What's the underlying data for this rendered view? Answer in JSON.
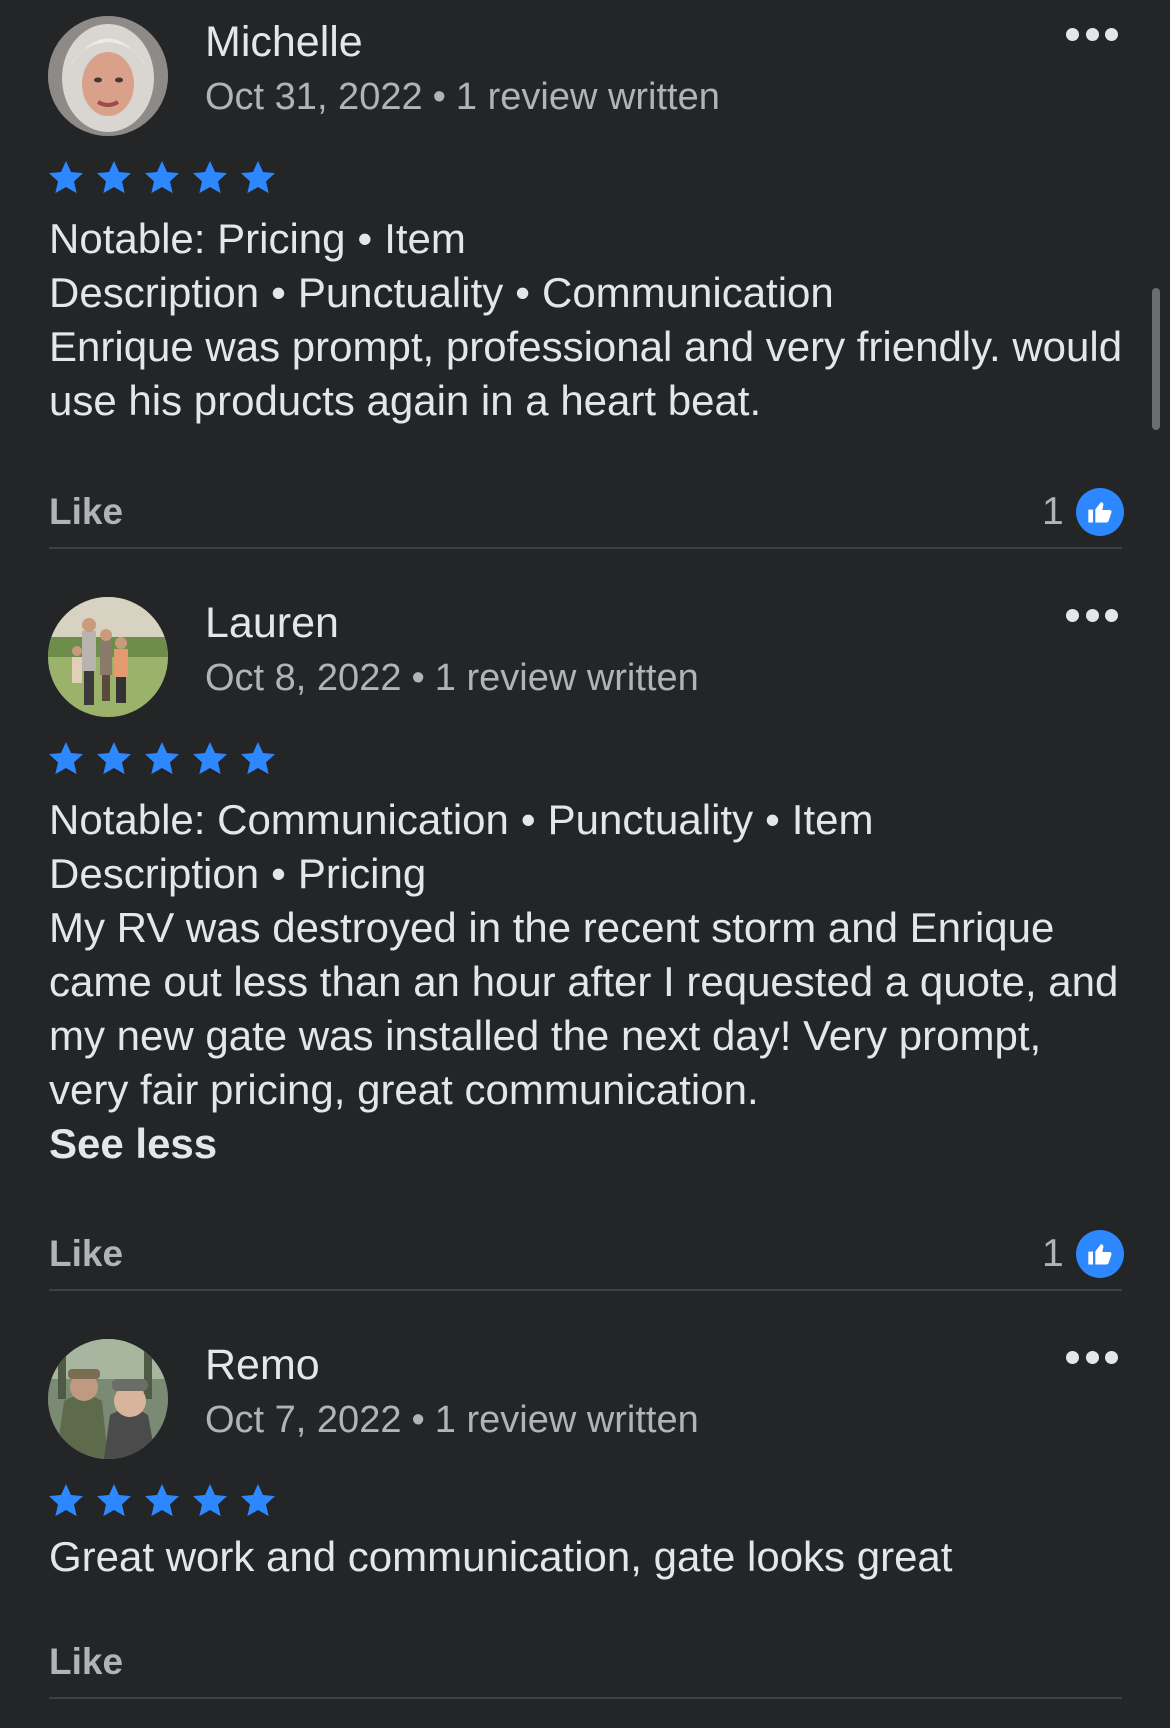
{
  "colors": {
    "background": "#242526",
    "primary_text": "#e4e6eb",
    "secondary_text": "#b0b3b8",
    "star": "#2d88ff",
    "like_badge": "#2d88ff",
    "divider": "#3e4042"
  },
  "icons": {
    "more": "three-dots-icon",
    "star": "star-icon",
    "like_badge": "thumbs-up-icon"
  },
  "reviews": [
    {
      "name": "Michelle",
      "date": "Oct 31, 2022",
      "meta_sep": "•",
      "reviews_written": "1 review written",
      "rating": 5,
      "notable_prefix": "Notable:",
      "notable_tags": [
        "Pricing",
        "Item Description",
        "Punctuality",
        "Communication"
      ],
      "tag_sep": "•",
      "text": "Enrique was prompt, professional and very friendly. would use his products again in a heart beat.",
      "like_label": "Like",
      "like_count": "1"
    },
    {
      "name": "Lauren",
      "date": "Oct 8, 2022",
      "meta_sep": "•",
      "reviews_written": "1 review written",
      "rating": 5,
      "notable_prefix": "Notable:",
      "notable_tags": [
        "Communication",
        "Punctuality",
        "Item Description",
        "Pricing"
      ],
      "tag_sep": "•",
      "text": "My RV was destroyed in the recent storm and Enrique came out less than an hour after I requested a quote, and my new gate was installed the next day! Very prompt, very fair pricing, great communication.",
      "see_less_label": "See less",
      "like_label": "Like",
      "like_count": "1"
    },
    {
      "name": "Remo",
      "date": "Oct 7, 2022",
      "meta_sep": "•",
      "reviews_written": "1 review written",
      "rating": 5,
      "text": "Great work and communication, gate looks great",
      "like_label": "Like"
    }
  ]
}
